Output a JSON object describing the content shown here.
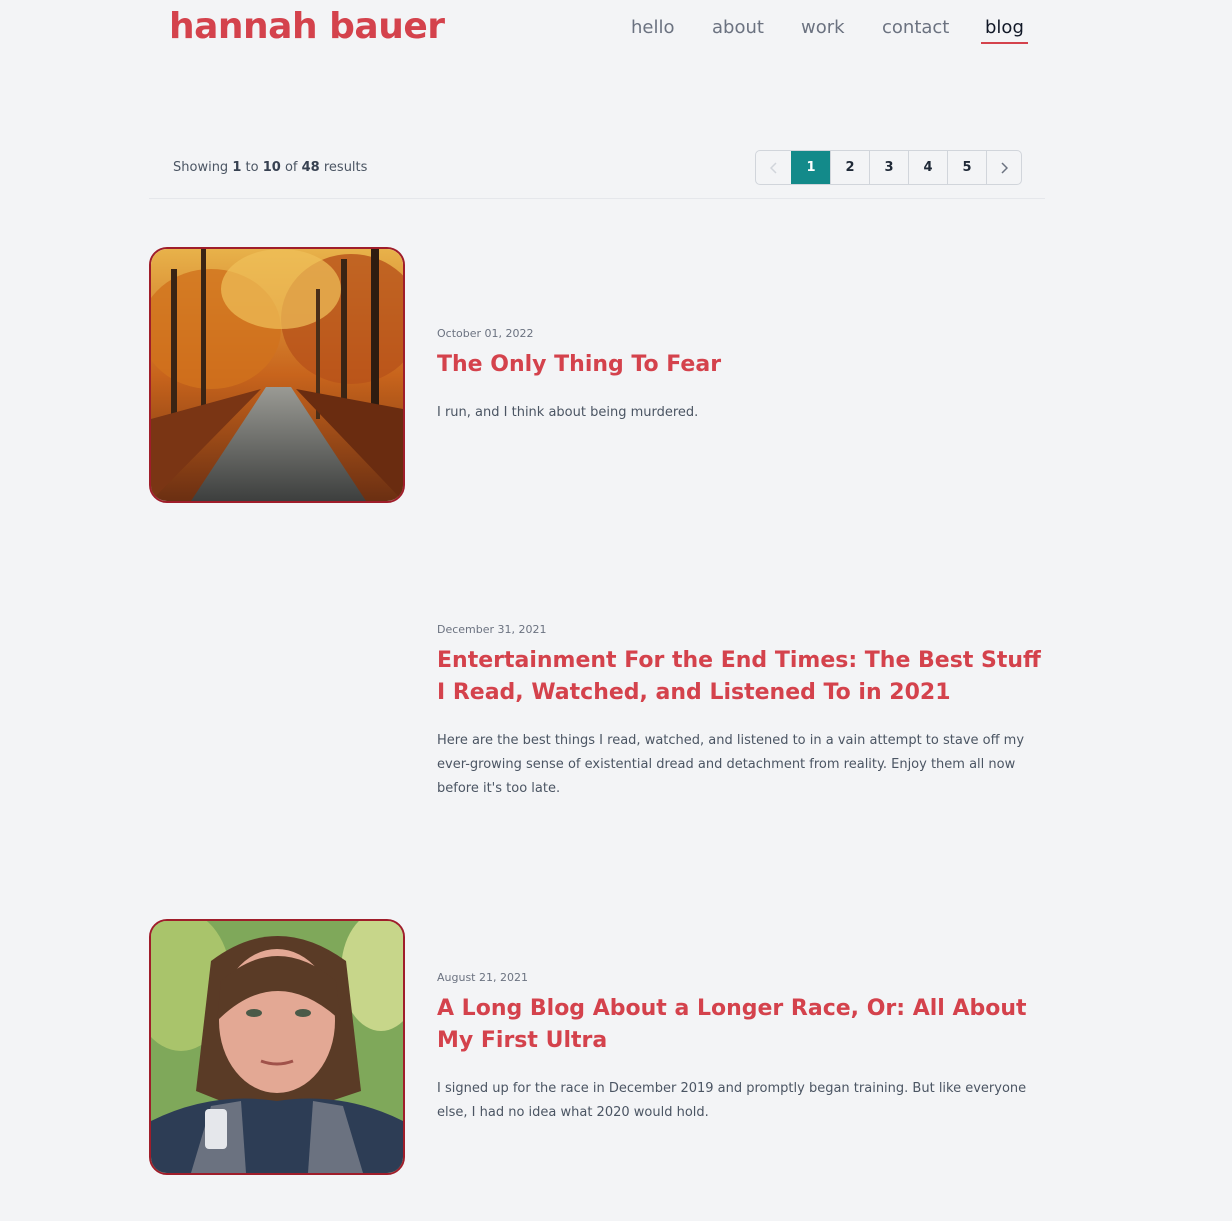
{
  "site": {
    "title": "hannah bauer"
  },
  "nav": {
    "items": [
      {
        "label": "hello"
      },
      {
        "label": "about"
      },
      {
        "label": "work"
      },
      {
        "label": "contact"
      },
      {
        "label": "blog"
      }
    ],
    "active": "blog"
  },
  "results": {
    "prefix": "Showing",
    "from": "1",
    "to_word": "to",
    "to": "10",
    "of_word": "of",
    "total": "48",
    "suffix": "results"
  },
  "pagination": {
    "prev_icon": "chevron-left-icon",
    "pages": [
      "1",
      "2",
      "3",
      "4",
      "5"
    ],
    "current": "1",
    "next_icon": "chevron-right-icon"
  },
  "posts": [
    {
      "date": "October 01, 2022",
      "title": "The Only Thing To Fear",
      "excerpt": "I run, and I think about being murdered.",
      "image": "autumn-forest-road-photo"
    },
    {
      "date": "December 31, 2021",
      "title": "Entertainment For the End Times: The Best Stuff I Read, Watched, and Listened To in 2021",
      "excerpt": "Here are the best things I read, watched, and listened to in a vain attempt to stave off my ever-growing sense of existential dread and detachment from reality. Enjoy them all now before it's too late.",
      "image": ""
    },
    {
      "date": "August 21, 2021",
      "title": "A Long Blog About a Longer Race, Or: All About My First Ultra",
      "excerpt": "I signed up for the race in December 2019 and promptly began training. But like everyone else, I had no idea what 2020 would hold.",
      "image": "runner-selfie-photo"
    }
  ],
  "colors": {
    "accent": "#d4424c",
    "pager_active": "#138a8a",
    "background": "#f3f4f6"
  }
}
